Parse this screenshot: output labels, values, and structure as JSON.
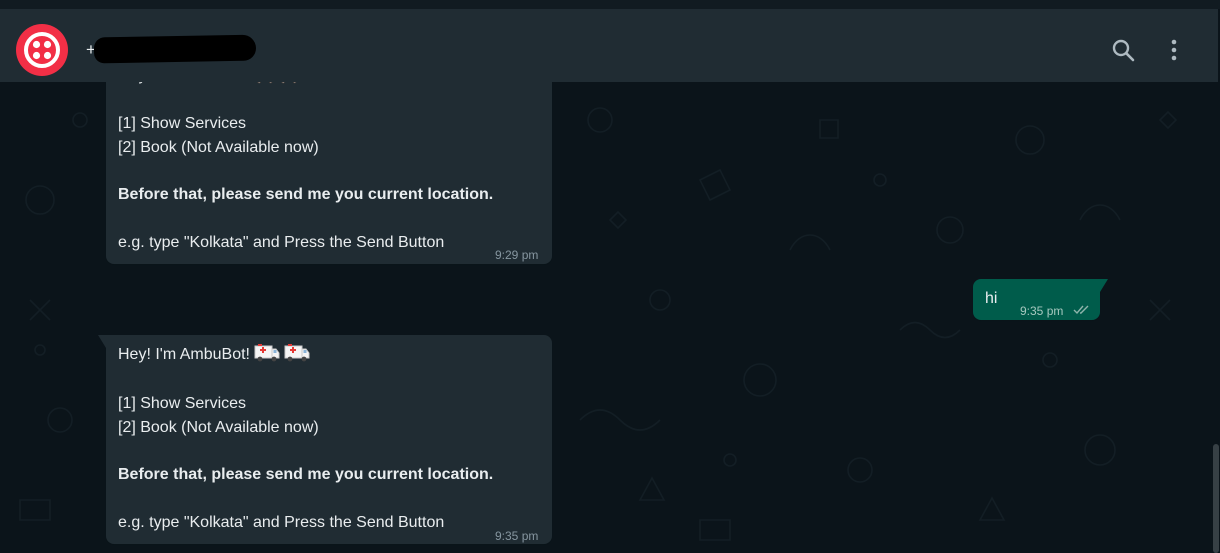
{
  "header": {
    "contact_name": "+",
    "search_icon": "search-icon",
    "menu_icon": "more-vertical-icon"
  },
  "messages": [
    {
      "direction": "incoming",
      "lines": [
        "[1] Show Services",
        "[2] Book (Not Available now)",
        "Before that, please send me you current location.",
        "e.g. type \"Kolkata\" and Press the Send Button"
      ],
      "time": "9:29 pm"
    },
    {
      "direction": "outgoing",
      "text": "hi",
      "time": "9:35 pm",
      "status_icon": "double-check-icon"
    },
    {
      "direction": "incoming",
      "greeting": "Hey! I'm AmbuBot!",
      "greeting_emoji": "ambulance-icon",
      "lines": [
        "[1] Show Services",
        "[2] Book (Not Available now)",
        "Before that, please send me you current location.",
        "e.g. type \"Kolkata\" and Press the Send Button"
      ],
      "time": "9:35 pm"
    }
  ],
  "colors": {
    "background": "#0b141a",
    "header": "#202c33",
    "incoming_bubble": "#202c33",
    "outgoing_bubble": "#005c4b",
    "avatar": "#f22f46",
    "text": "#e9edef",
    "meta": "#8696a0"
  }
}
